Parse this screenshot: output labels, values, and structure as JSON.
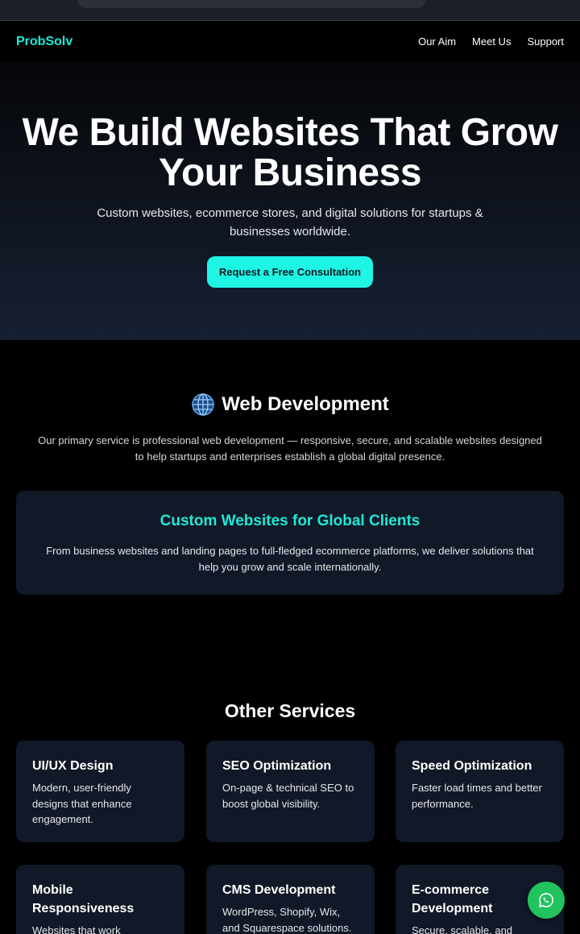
{
  "nav": {
    "logo": "ProbSolv",
    "links": [
      "Our Aim",
      "Meet Us",
      "Support"
    ]
  },
  "hero": {
    "title": "We Build Websites That Grow Your Business",
    "subtitle": "Custom websites, ecommerce stores, and digital solutions for startups & businesses worldwide.",
    "cta_label": "Request a Free Consultation"
  },
  "web_dev": {
    "icon": "globe-icon",
    "title": "Web Development",
    "description": "Our primary service is professional web development — responsive, secure, and scalable websites designed to help startups and enterprises establish a global digital presence.",
    "card": {
      "title": "Custom Websites for Global Clients",
      "description": "From business websites and landing pages to full-fledged ecommerce platforms, we deliver solutions that help you grow and scale internationally."
    }
  },
  "other_services": {
    "title": "Other Services",
    "items": [
      {
        "title": "UI/UX Design",
        "description": "Modern, user-friendly designs that enhance engagement."
      },
      {
        "title": "SEO Optimization",
        "description": "On-page & technical SEO to boost global visibility."
      },
      {
        "title": "Speed Optimization",
        "description": "Faster load times and better performance."
      },
      {
        "title": "Mobile Responsiveness",
        "description": "Websites that work"
      },
      {
        "title": "CMS Development",
        "description": "WordPress, Shopify, Wix, and Squarespace solutions."
      },
      {
        "title": "E-commerce Development",
        "description": "Secure, scalable, and"
      }
    ]
  },
  "colors": {
    "accent": "#1de9d6",
    "cta_bg": "#1ff5e4",
    "card_bg": "#111827",
    "whatsapp": "#22c35e"
  },
  "floating": {
    "icon": "whatsapp-icon"
  }
}
